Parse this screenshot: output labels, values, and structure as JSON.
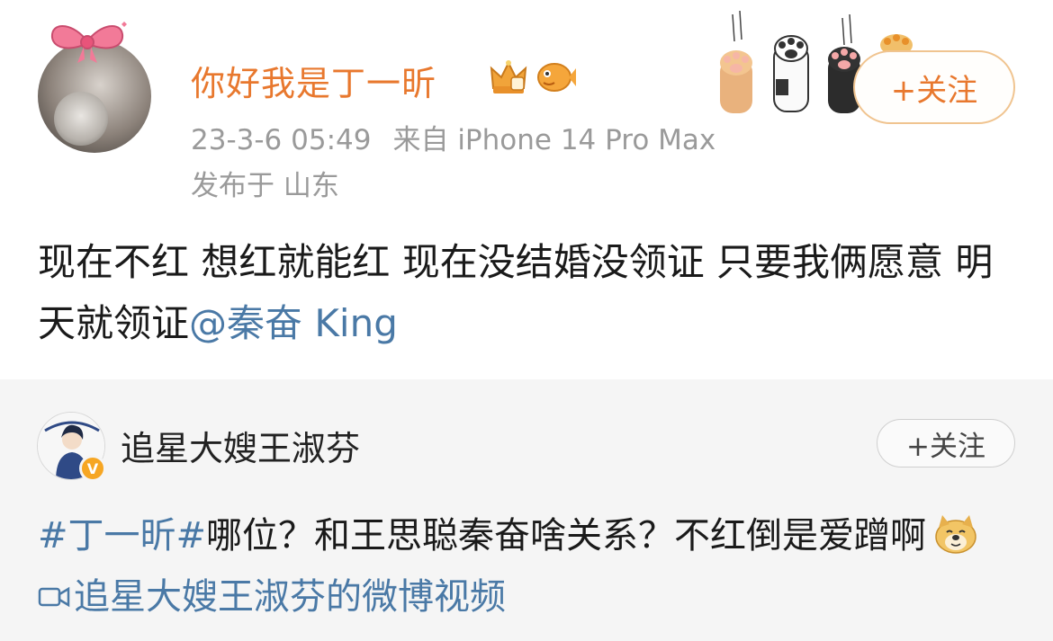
{
  "post": {
    "author": "你好我是丁一昕",
    "timestamp": "23-3-6 05:49",
    "source": "来自 iPhone 14 Pro Max",
    "location": "发布于 山东",
    "follow_label": "+关注",
    "text": "现在不红 想红就能红 现在没结婚没领证 只要我俩愿意 明天就领证",
    "mention": "@秦奋 King",
    "badges": [
      "crown-badge-icon",
      "fish-badge-icon"
    ],
    "colors": {
      "name": "#e8782e",
      "link": "#4a79a6",
      "meta": "#9a9a9a"
    }
  },
  "repost": {
    "author": "追星大嫂王淑芬",
    "follow_label": "+关注",
    "hashtag": "#丁一昕#",
    "text": "哪位？和王思聪秦奋啥关系？不红倒是爱蹭啊",
    "emoji": "doge-emoji-icon",
    "video_link": "追星大嫂王淑芬的微博视频",
    "verified_badge": "V"
  }
}
